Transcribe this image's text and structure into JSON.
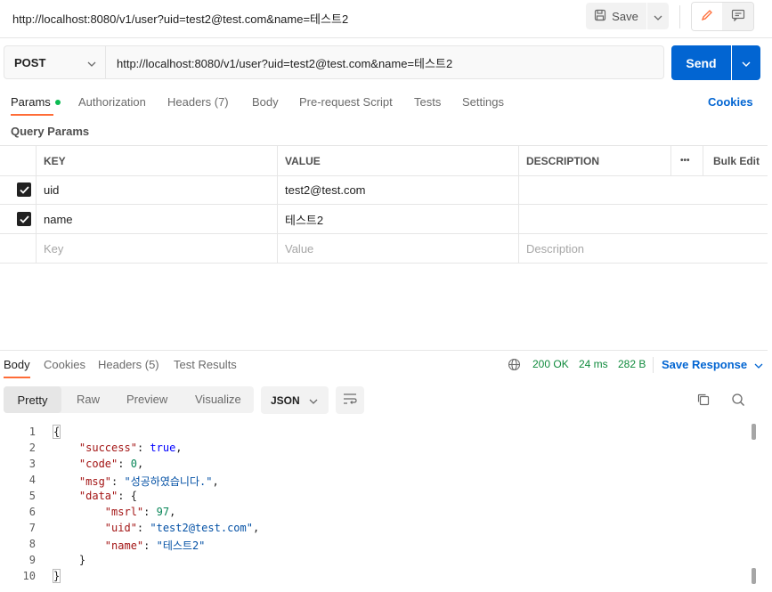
{
  "title_bar": {
    "url": "http://localhost:8080/v1/user?uid=test2@test.com&name=테스트2",
    "save_label": "Save"
  },
  "request": {
    "method": "POST",
    "url": "http://localhost:8080/v1/user?uid=test2@test.com&name=테스트2",
    "send_label": "Send"
  },
  "request_tabs": [
    {
      "label": "Params"
    },
    {
      "label": "Authorization"
    },
    {
      "label": "Headers (7)"
    },
    {
      "label": "Body"
    },
    {
      "label": "Pre-request Script"
    },
    {
      "label": "Tests"
    },
    {
      "label": "Settings"
    }
  ],
  "cookies_label": "Cookies",
  "query_params": {
    "title": "Query Params",
    "headers": {
      "key": "KEY",
      "value": "VALUE",
      "description": "DESCRIPTION",
      "more": "•••",
      "bulk_edit": "Bulk Edit"
    },
    "rows": [
      {
        "key": "uid",
        "value": "test2@test.com",
        "description": "",
        "checked": true
      },
      {
        "key": "name",
        "value": "테스트2",
        "description": "",
        "checked": true
      }
    ],
    "placeholder": {
      "key": "Key",
      "value": "Value",
      "description": "Description"
    }
  },
  "response": {
    "tabs": [
      {
        "label": "Body"
      },
      {
        "label": "Cookies"
      },
      {
        "label": "Headers (5)"
      },
      {
        "label": "Test Results"
      }
    ],
    "status": "200 OK",
    "time": "24 ms",
    "size": "282 B",
    "save_response": "Save Response",
    "view_modes": [
      "Pretty",
      "Raw",
      "Preview",
      "Visualize"
    ],
    "format": "JSON",
    "line_numbers": [
      "1",
      "2",
      "3",
      "4",
      "5",
      "6",
      "7",
      "8",
      "9",
      "10"
    ],
    "code": {
      "l1": "{",
      "success_key": "\"success\"",
      "success_val": "true",
      "code_key": "\"code\"",
      "code_val": "0",
      "msg_key": "\"msg\"",
      "msg_val": "\"성공하였습니다.\"",
      "data_key": "\"data\"",
      "data_open": "{",
      "msrl_key": "\"msrl\"",
      "msrl_val": "97",
      "uid_key": "\"uid\"",
      "uid_val": "\"test2@test.com\"",
      "name_key": "\"name\"",
      "name_val": "\"테스트2\"",
      "data_close": "}",
      "l10": "}"
    }
  }
}
